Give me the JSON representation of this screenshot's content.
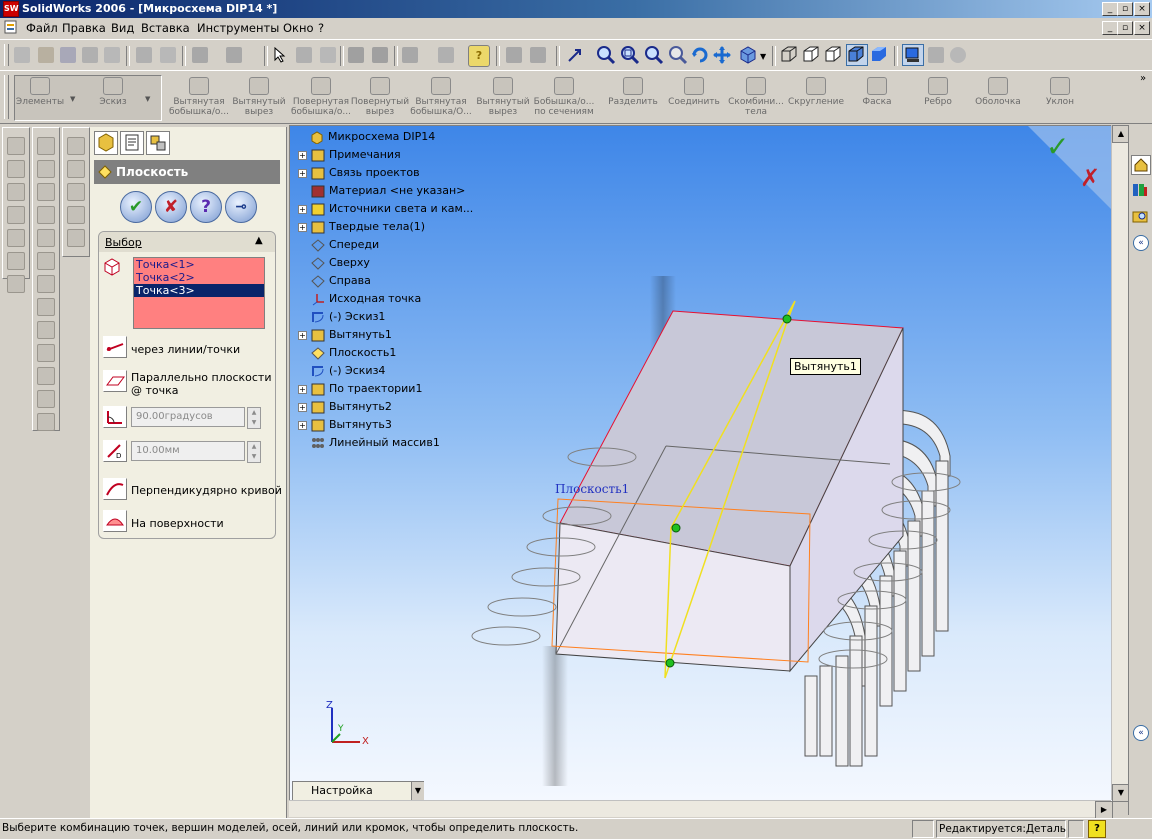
{
  "window": {
    "app_title": "SolidWorks 2006 - [Микросхема DIP14 *]",
    "controls": [
      "_",
      "▫",
      "×"
    ]
  },
  "menu": {
    "items": [
      "Файл",
      "Правка",
      "Вид",
      "Вставка",
      "Инструменты",
      "Окно",
      "?"
    ]
  },
  "features_toolbar": {
    "items": [
      {
        "label": "Элементы",
        "icon": "features-icon"
      },
      {
        "label": "Эскиз",
        "icon": "sketch-icon"
      },
      {
        "label": "Вытянутая бобышка/о...",
        "icon": "extrude-boss-icon"
      },
      {
        "label": "Вытянутый вырез",
        "icon": "extrude-cut-icon"
      },
      {
        "label": "Повернутая бобышка/о...",
        "icon": "revolve-boss-icon"
      },
      {
        "label": "Повернутый вырез",
        "icon": "revolve-cut-icon"
      },
      {
        "label": "Вытянутая бобышка/О...",
        "icon": "sweep-boss-icon"
      },
      {
        "label": "Вытянутый вырез",
        "icon": "sweep-cut-icon"
      },
      {
        "label": "Бобышка/о... по сечениям",
        "icon": "loft-icon"
      },
      {
        "label": "Разделить",
        "icon": "split-icon"
      },
      {
        "label": "Соединить",
        "icon": "join-icon"
      },
      {
        "label": "Скомбини... тела",
        "icon": "combine-icon"
      },
      {
        "label": "Скругление",
        "icon": "fillet-icon"
      },
      {
        "label": "Фаска",
        "icon": "chamfer-icon"
      },
      {
        "label": "Ребро",
        "icon": "rib-icon"
      },
      {
        "label": "Оболочка",
        "icon": "shell-icon"
      },
      {
        "label": "Уклон",
        "icon": "draft-icon"
      }
    ]
  },
  "property_manager": {
    "title": "Плоскость",
    "section_title": "Выбор",
    "selections": [
      "Точка<1>",
      "Точка<2>",
      "Точка<3>"
    ],
    "selected_index": 2,
    "options": {
      "through_lines_points": "через линии/точки",
      "parallel_plane_line1": "Параллельно плоскости",
      "parallel_plane_line2": "@ точка",
      "angle_value": "90.00градусов",
      "offset_value": "10.00мм",
      "normal_to_curve": "Перпендикудярно кривой",
      "on_surface": "На поверхности"
    }
  },
  "feature_tree": {
    "root": "Микросхема DIP14",
    "items": [
      {
        "label": "Примечания",
        "icon": "annotations-icon",
        "expandable": true
      },
      {
        "label": "Связь проектов",
        "icon": "design-binder-icon",
        "expandable": true
      },
      {
        "label": "Материал <не указан>",
        "icon": "material-icon",
        "expandable": false
      },
      {
        "label": "Источники света и кам...",
        "icon": "lights-icon",
        "expandable": true
      },
      {
        "label": "Твердые тела(1)",
        "icon": "solid-bodies-icon",
        "expandable": true
      },
      {
        "label": "Спереди",
        "icon": "plane-icon",
        "expandable": false
      },
      {
        "label": "Сверху",
        "icon": "plane-icon",
        "expandable": false
      },
      {
        "label": "Справа",
        "icon": "plane-icon",
        "expandable": false
      },
      {
        "label": "Исходная точка",
        "icon": "origin-icon",
        "expandable": false
      },
      {
        "label": "(-) Эскиз1",
        "icon": "sketch-icon",
        "expandable": false
      },
      {
        "label": "Вытянуть1",
        "icon": "extrude-icon",
        "expandable": true
      },
      {
        "label": "Плоскость1",
        "icon": "plane-icon",
        "expandable": false
      },
      {
        "label": "(-) Эскиз4",
        "icon": "sketch-icon",
        "expandable": false
      },
      {
        "label": "По траектории1",
        "icon": "sweep-icon",
        "expandable": true
      },
      {
        "label": "Вытянуть2",
        "icon": "extrude-icon",
        "expandable": true
      },
      {
        "label": "Вытянуть3",
        "icon": "extrude-icon",
        "expandable": true
      },
      {
        "label": "Линейный массив1",
        "icon": "linear-pattern-icon",
        "expandable": false
      }
    ]
  },
  "viewport": {
    "tooltip": "Вытянуть1",
    "plane_label": "Плоскость1",
    "axis_x": "X",
    "axis_y": "Y",
    "axis_z": "Z",
    "config_dropdown": "Настройка"
  },
  "status_bar": {
    "message": "Выберите комбинацию точек, вершин моделей, осей, линий или кромок, чтобы определить плоскость.",
    "mode": "Редактируется:Деталь",
    "help": "?"
  },
  "colors": {
    "accent": "#0a246a",
    "viewport_top": "#3e86e8",
    "viewport_bottom": "#f4f8ff",
    "selection_box": "#ff8080",
    "selected_row": "#0a246a",
    "ok_green": "#2a9a2a",
    "cancel_red": "#c0202a"
  }
}
